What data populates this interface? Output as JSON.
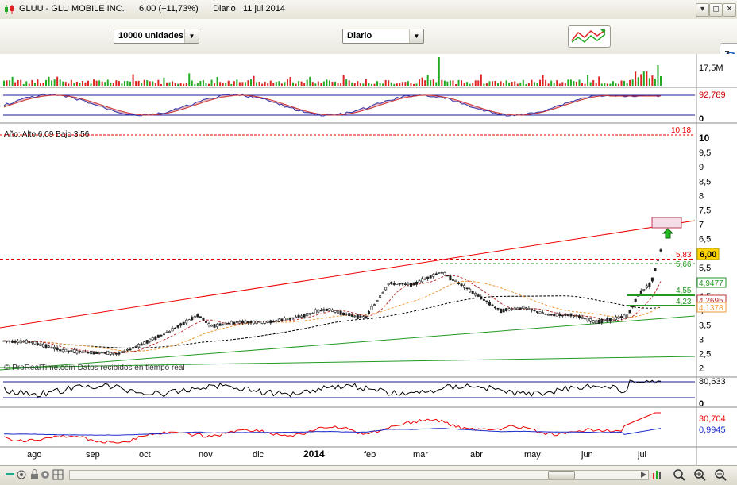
{
  "window": {
    "symbol": "GLUU",
    "company": "GLU MOBILE INC.",
    "price": "6,00",
    "change": "(+11,73%)",
    "period": "Diario",
    "date": "11 jul 2014"
  },
  "toolbar": {
    "units_select": "10000 unidades",
    "period_select": "Diario"
  },
  "panels": {
    "volume": {
      "label": "17,5M"
    },
    "stoch": {
      "value": "92,789",
      "zero": "0"
    },
    "price": {
      "legend": "Año: Alto 6,09  Bajo 3,56",
      "watermark": "© ProRealTime.com  Datos recibidos en tiempo real",
      "axis": [
        "10",
        "9,5",
        "9",
        "8,5",
        "8",
        "7,5",
        "7",
        "6,5",
        "6",
        "5,5",
        "5",
        "4,5",
        "4",
        "3,5",
        "3",
        "2,5",
        "2"
      ],
      "last_price": "6,00",
      "resistance_label": "10,18",
      "levels": {
        "l583": "5,83",
        "l566": "5,66",
        "l455": "4,55",
        "l423": "4,23",
        "ma1": "4,9477",
        "ma2": "4,2695",
        "ma3": "4,1378"
      }
    },
    "rsi": {
      "value": "80,633",
      "zero": "0"
    },
    "macd": {
      "value1": "30,704",
      "value2": "0,9945"
    }
  },
  "x_axis": [
    "ago",
    "sep",
    "oct",
    "nov",
    "dic",
    "2014",
    "feb",
    "mar",
    "abr",
    "may",
    "jun",
    "jul"
  ],
  "colors": {
    "up": "#22aa22",
    "down": "#dd2222",
    "ma_short": "#bb3333",
    "ma_mid": "#ee9933",
    "trend_red": "#e00000",
    "trend_green": "#229922"
  }
}
